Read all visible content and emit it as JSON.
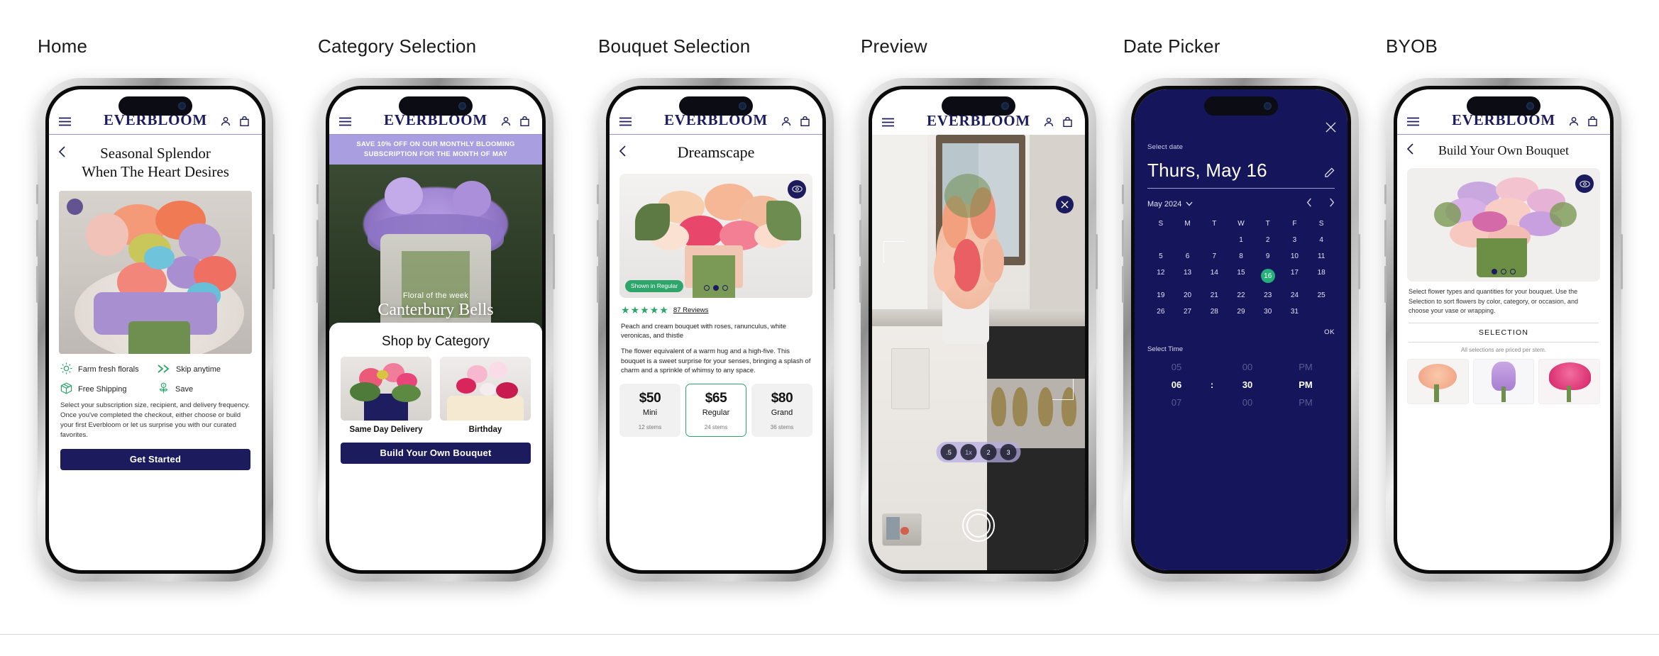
{
  "brand": "EVERBLOOM",
  "colors": {
    "navy": "#1b1b5e",
    "lilac": "#a99fe0",
    "green": "#2ea56b",
    "picker_bg": "#15155c",
    "today_green": "#23b07a"
  },
  "screens": [
    {
      "label": "Home",
      "back_icon": "chevron-left-icon",
      "title_line1": "Seasonal Splendor",
      "title_line2": "When The Heart Desires",
      "features": [
        {
          "icon": "sun-icon",
          "label": "Farm fresh florals"
        },
        {
          "icon": "chevrons-right-icon",
          "label": "Skip anytime"
        },
        {
          "icon": "box-icon",
          "label": "Free Shipping"
        },
        {
          "icon": "savings-plant-icon",
          "label": "Save"
        }
      ],
      "blurb": "Select your subscription size, recipient, and delivery frequency. Once you've completed the checkout, either choose or build your first Everbloom or let us surprise you with our curated favorites.",
      "cta": "Get Started"
    },
    {
      "label": "Category Selection",
      "promo": "SAVE 10% OFF ON OUR MONTHLY BLOOMING SUBSCRIPTION FOR THE MONTH OF MAY",
      "banner_kicker": "Floral of the week",
      "banner_name": "Canterbury Bells",
      "shop_heading": "Shop by Category",
      "categories": [
        {
          "label": "Same Day Delivery"
        },
        {
          "label": "Birthday"
        }
      ],
      "cta": "Build Your Own Bouquet"
    },
    {
      "label": "Bouquet Selection",
      "back_icon": "chevron-left-icon",
      "title": "Dreamscape",
      "eye_icon": "eye-icon",
      "size_badge": "Shown in Regular",
      "carousel_dots": 3,
      "carousel_active": 2,
      "stars": 5,
      "reviews": "87 Reviews",
      "desc1": "Peach and cream bouquet with roses, ranunculus, white veronicas, and thistle",
      "desc2": "The flower equivalent of a warm hug and a high-five. This bouquet is a sweet surprise for your senses, bringing a splash of charm and a sprinkle of whimsy to any space.",
      "prices": [
        {
          "amount": "$50",
          "name": "Mini",
          "stems": "12 stems",
          "selected": false
        },
        {
          "amount": "$65",
          "name": "Regular",
          "stems": "24 stems",
          "selected": true
        },
        {
          "amount": "$80",
          "name": "Grand",
          "stems": "36 stems",
          "selected": false
        }
      ]
    },
    {
      "label": "Preview",
      "close_icon": "close-icon",
      "zoom_levels": [
        ".5",
        "1x",
        "2",
        "3"
      ],
      "zoom_active": "1x",
      "shutter_icon": "shutter-icon",
      "thumbnail_icon": "gallery-thumbnail"
    },
    {
      "label": "Date Picker",
      "close_icon": "close-icon",
      "select_date_label": "Select date",
      "selected_date": "Thurs, May 16",
      "edit_icon": "pencil-icon",
      "month": "May 2024",
      "month_dropdown_icon": "chevron-down-icon",
      "prev_icon": "chevron-left-icon",
      "next_icon": "chevron-right-icon",
      "weekdays": [
        "S",
        "M",
        "T",
        "W",
        "T",
        "F",
        "S"
      ],
      "lead_blanks": 3,
      "days": [
        1,
        2,
        3,
        4,
        5,
        6,
        7,
        8,
        9,
        10,
        11,
        12,
        13,
        14,
        15,
        16,
        17,
        18,
        19,
        20,
        21,
        22,
        23,
        24,
        25,
        26,
        27,
        28,
        29,
        30,
        31
      ],
      "today": 16,
      "ok_label": "OK",
      "select_time_label": "Select Time",
      "time_rows": [
        {
          "hour": "05",
          "sep": "",
          "minute": "00",
          "period": "PM",
          "selected": false
        },
        {
          "hour": "06",
          "sep": ":",
          "minute": "30",
          "period": "PM",
          "selected": true
        },
        {
          "hour": "07",
          "sep": "",
          "minute": "00",
          "period": "PM",
          "selected": false
        }
      ]
    },
    {
      "label": "BYOB",
      "back_icon": "chevron-left-icon",
      "title": "Build Your Own Bouquet",
      "eye_icon": "eye-icon",
      "carousel_dots": 3,
      "carousel_active": 1,
      "desc": "Select flower types and quantities for your bouquet. Use the Selection to sort flowers by color, category, or occasion, and choose your vase or wrapping.",
      "selection_header": "SELECTION",
      "selection_note": "All selections are priced per stem.",
      "flowers": [
        "peach-rose",
        "purple-stock",
        "pink-lily"
      ]
    }
  ]
}
